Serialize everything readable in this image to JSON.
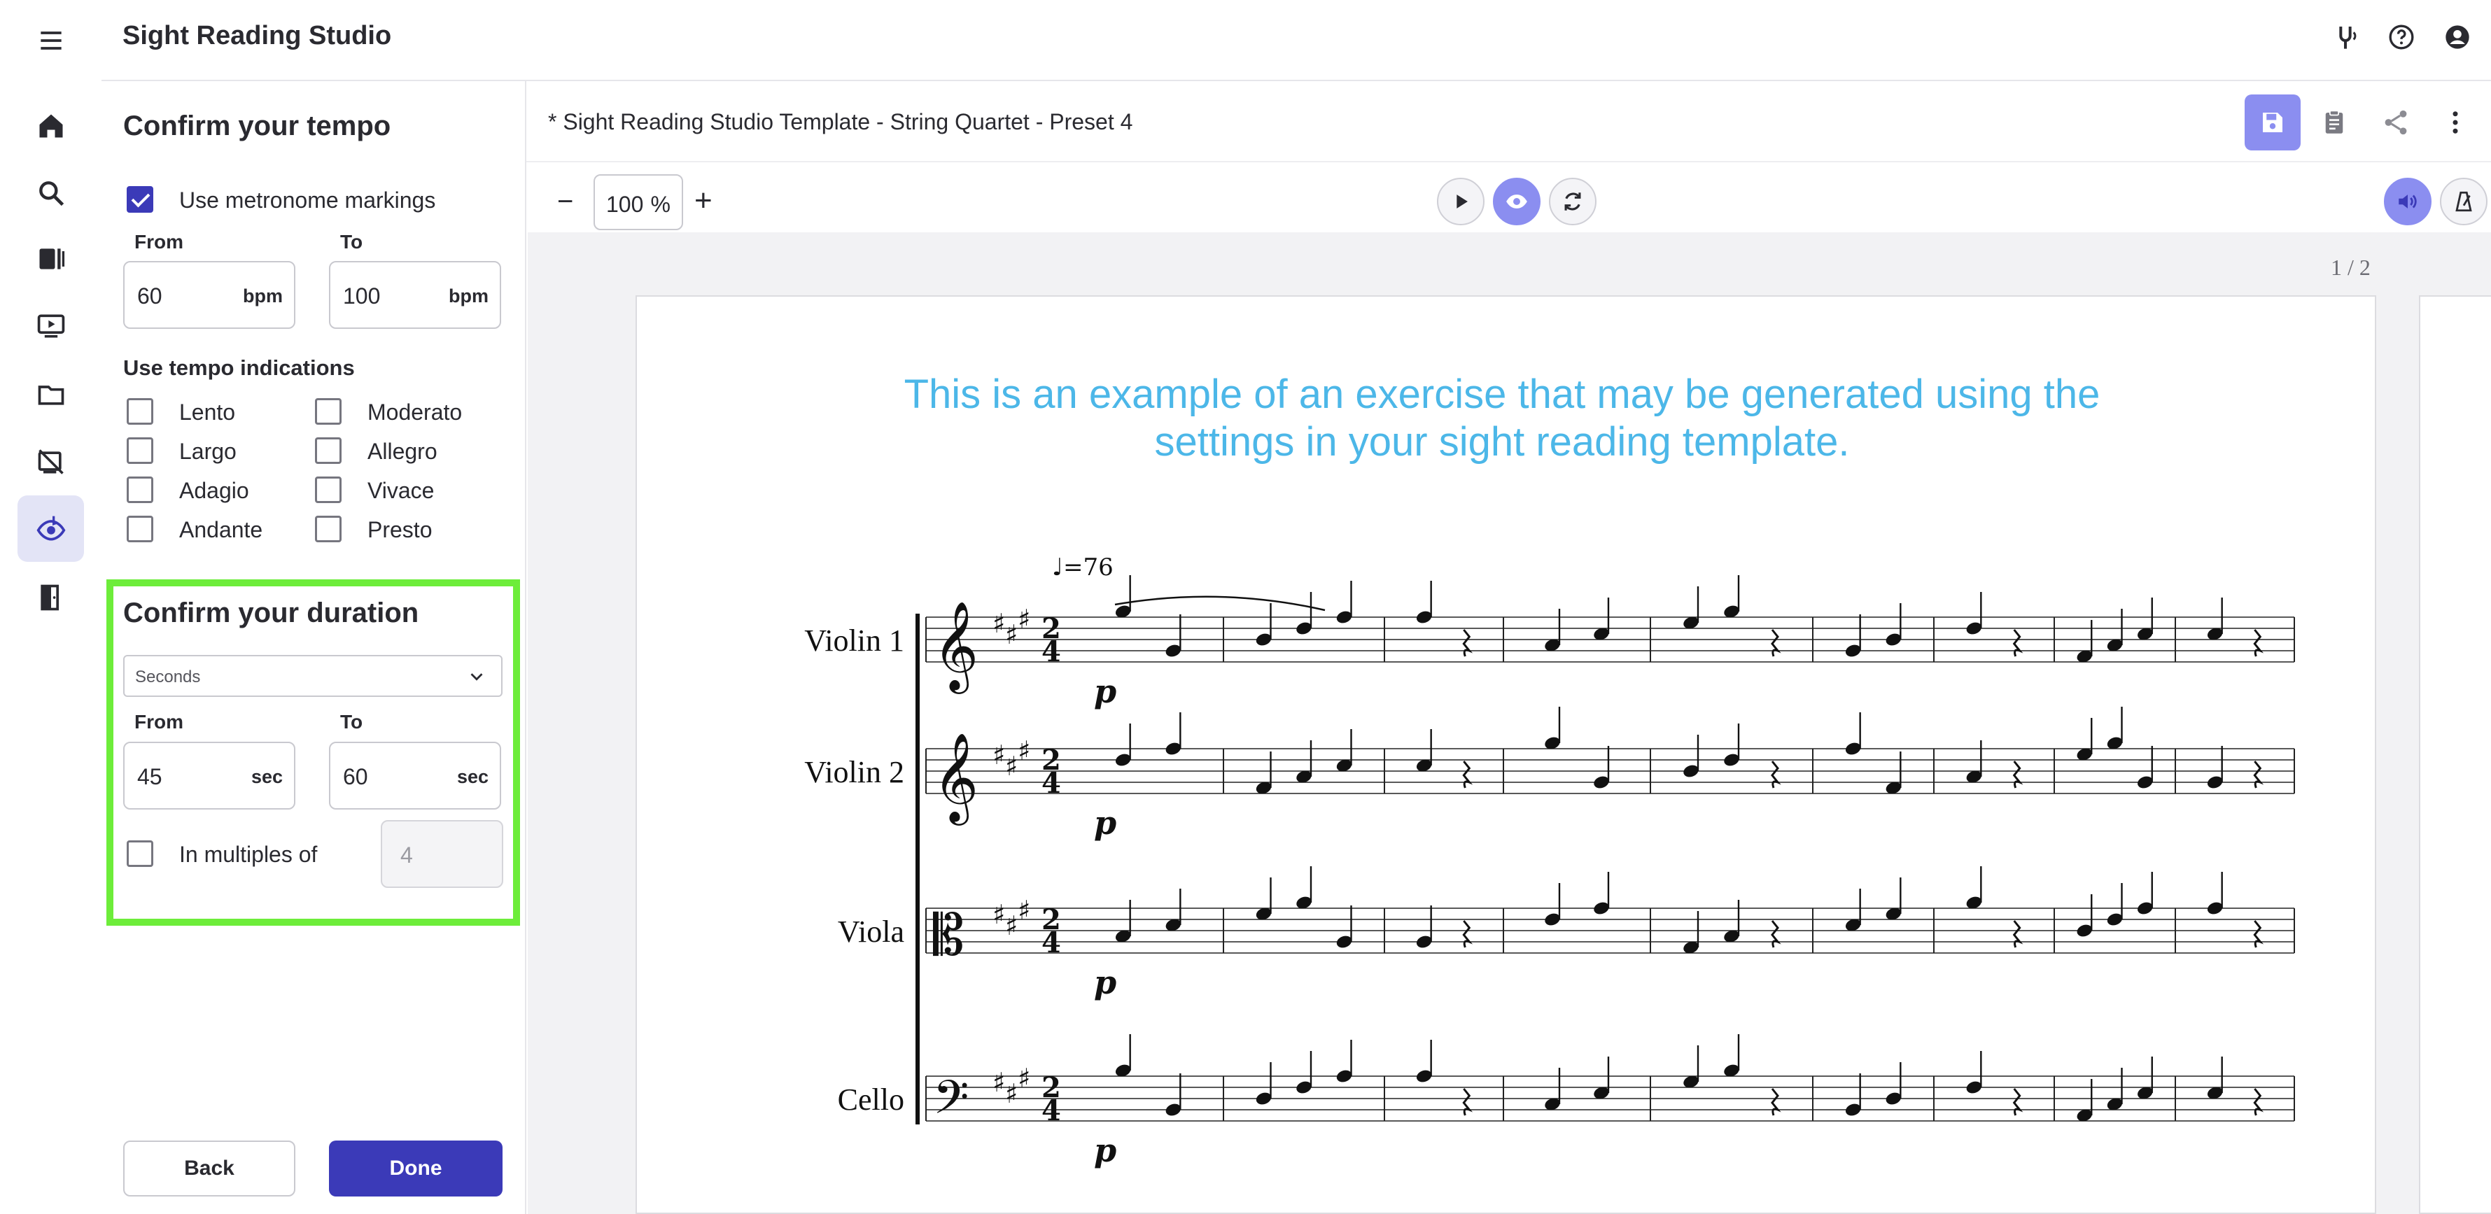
{
  "app": {
    "title": "Sight Reading Studio"
  },
  "rail": {
    "items": [
      {
        "name": "menu-icon"
      },
      {
        "name": "home-icon"
      },
      {
        "name": "search-icon"
      },
      {
        "name": "library-icon"
      },
      {
        "name": "video-icon"
      },
      {
        "name": "folder-icon"
      },
      {
        "name": "assignments-icon"
      },
      {
        "name": "sight-reading-icon",
        "active": true
      },
      {
        "name": "exit-icon"
      }
    ]
  },
  "top_icons": [
    "tuning-fork-icon",
    "help-icon",
    "account-icon"
  ],
  "panel": {
    "tempo": {
      "heading": "Confirm your tempo",
      "metronome_label": "Use metronome markings",
      "metronome_checked": true,
      "from_label": "From",
      "to_label": "To",
      "from_value": "60",
      "to_value": "100",
      "unit": "bpm",
      "indications_label": "Use tempo indications",
      "indications": [
        "Lento",
        "Largo",
        "Adagio",
        "Andante",
        "Moderato",
        "Allegro",
        "Vivace",
        "Presto"
      ]
    },
    "duration": {
      "heading": "Confirm your duration",
      "unit_select": "Seconds",
      "from_label": "From",
      "to_label": "To",
      "from_value": "45",
      "to_value": "60",
      "unit": "sec",
      "multiples_label": "In multiples of",
      "multiples_value": "4",
      "multiples_checked": false
    },
    "back_label": "Back",
    "done_label": "Done"
  },
  "document": {
    "title": "* Sight Reading Studio Template - String Quartet - Preset 4",
    "actions": [
      "save-icon",
      "clipboard-icon",
      "share-icon",
      "more-vert-icon"
    ],
    "accent": "#8b8ef0"
  },
  "toolbar": {
    "zoom_value": "100",
    "zoom_unit": "%",
    "zoom_minus": "−",
    "zoom_plus": "+",
    "playback": [
      "play-icon",
      "eye-icon",
      "refresh-icon"
    ],
    "right": [
      "volume-icon",
      "metronome-icon"
    ]
  },
  "score": {
    "page_indicator": "1 / 2",
    "note": "This is an example of an exercise that may be generated using the settings in your sight reading template.",
    "tempo_marking": "♩=76",
    "instruments": [
      "Violin 1",
      "Violin 2",
      "Viola",
      "Cello"
    ],
    "time_signature": "2/4",
    "key_signature": "3 sharps",
    "dynamic": "p",
    "note_color": "#4cb7e8"
  }
}
